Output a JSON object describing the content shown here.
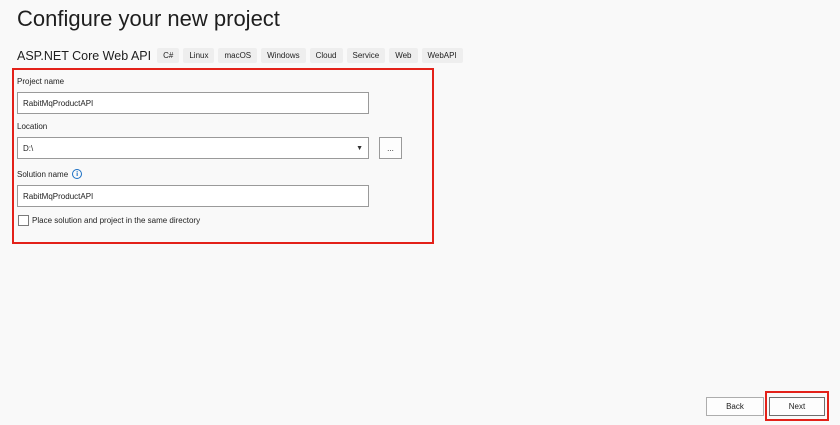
{
  "header": {
    "title": "Configure your new project"
  },
  "template": {
    "name": "ASP.NET Core Web API",
    "tags": [
      "C#",
      "Linux",
      "macOS",
      "Windows",
      "Cloud",
      "Service",
      "Web",
      "WebAPI"
    ]
  },
  "form": {
    "project_name": {
      "label": "Project name",
      "value": "RabitMqProductAPI"
    },
    "location": {
      "label": "Location",
      "value": "D:\\",
      "browse_label": "..."
    },
    "solution_name": {
      "label": "Solution name",
      "info_glyph": "i",
      "value": "RabitMqProductAPI"
    },
    "same_directory": {
      "label": "Place solution and project in the same directory",
      "checked": false
    }
  },
  "footer": {
    "back_label": "Back",
    "next_label": "Next"
  },
  "icons": {
    "dropdown": "chevron-down-icon",
    "info": "info-icon"
  },
  "colors": {
    "highlight": "#e32119",
    "info_accent": "#1a6fc4",
    "background": "#f9f9f9"
  }
}
